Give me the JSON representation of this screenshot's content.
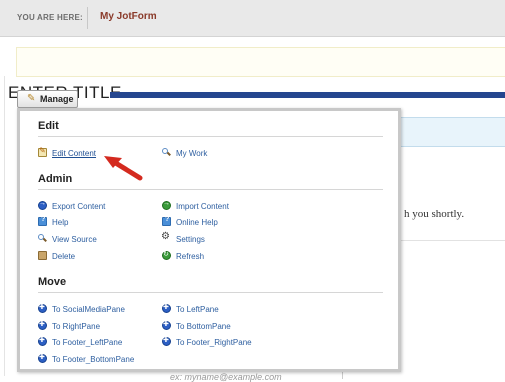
{
  "breadcrumb": {
    "label": "YOU ARE HERE:",
    "link": "My JotForm"
  },
  "page": {
    "notice_text": "",
    "title": "ENTER TITLE",
    "bg_text": "h you shortly.",
    "input_placeholder": "ex: myname@example.com"
  },
  "manage": {
    "label": "Manage",
    "icon": "pencil-icon"
  },
  "menu": {
    "edit": {
      "title": "Edit",
      "items": [
        {
          "label": "Edit Content",
          "icon": "edit-page-icon"
        },
        {
          "label": "My Work",
          "icon": "magnifier-icon"
        }
      ]
    },
    "admin": {
      "title": "Admin",
      "items": [
        {
          "label": "Export Content",
          "icon": "export-icon"
        },
        {
          "label": "Import Content",
          "icon": "import-icon"
        },
        {
          "label": "Help",
          "icon": "help-icon"
        },
        {
          "label": "Online Help",
          "icon": "online-help-icon"
        },
        {
          "label": "View Source",
          "icon": "magnifier-icon"
        },
        {
          "label": "Settings",
          "icon": "gear-icon"
        },
        {
          "label": "Delete",
          "icon": "trash-icon"
        },
        {
          "label": "Refresh",
          "icon": "refresh-icon"
        }
      ]
    },
    "move": {
      "title": "Move",
      "items": [
        {
          "label": "To SocialMediaPane",
          "icon": "move-icon"
        },
        {
          "label": "To LeftPane",
          "icon": "move-icon"
        },
        {
          "label": "To RightPane",
          "icon": "move-icon"
        },
        {
          "label": "To BottomPane",
          "icon": "move-icon"
        },
        {
          "label": "To Footer_LeftPane",
          "icon": "move-icon"
        },
        {
          "label": "To Footer_RightPane",
          "icon": "move-icon"
        },
        {
          "label": "To Footer_BottomPane",
          "icon": "move-icon"
        }
      ]
    }
  },
  "colors": {
    "accent": "#25468f",
    "link": "#2e5fa0",
    "arrow": "#d42a1f",
    "breadcrumb_link": "#8a3a2a"
  }
}
